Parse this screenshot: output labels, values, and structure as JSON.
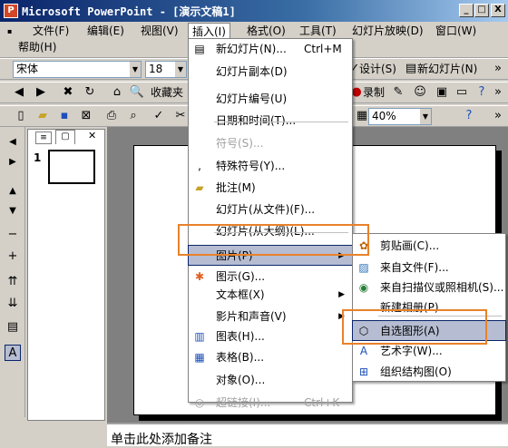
{
  "window": {
    "title": "Microsoft PowerPoint - [演示文稿1]",
    "minimize": "_",
    "restore": "□",
    "close": "X"
  },
  "menubar": {
    "file": "文件(F)",
    "edit": "编辑(E)",
    "view": "视图(V)",
    "insert": "插入(I)",
    "format": "格式(O)",
    "tools": "工具(T)",
    "slideshow": "幻灯片放映(D)",
    "window": "窗口(W)",
    "help": "帮助(H)"
  },
  "toolbar1": {
    "font_name": "宋体",
    "font_size": "18",
    "design": "设计(S)",
    "new_slide": "新幻灯片(N)"
  },
  "toolbar2": {
    "favorites": "收藏夹",
    "record": "录制"
  },
  "toolbar3": {
    "zoom": "40%"
  },
  "outline": {
    "slide_number": "1"
  },
  "notes": {
    "placeholder": "单击此处添加备注"
  },
  "insert_menu": {
    "items": [
      {
        "label": "新幻灯片(N)...",
        "shortcut": "Ctrl+M",
        "icon": "new-slide-icon",
        "disabled": false
      },
      {
        "label": "幻灯片副本(D)",
        "disabled": false
      },
      {
        "label": "幻灯片编号(U)",
        "disabled": false
      },
      {
        "label": "日期和时间(T)...",
        "disabled": false
      },
      {
        "label": "符号(S)...",
        "disabled": true
      },
      {
        "label": "特殊符号(Y)...",
        "icon": "comma-icon",
        "disabled": false
      },
      {
        "label": "批注(M)",
        "icon": "folder-icon",
        "disabled": false
      },
      {
        "label": "幻灯片(从文件)(F)...",
        "disabled": false
      },
      {
        "label": "幻灯片(从大纲)(L)...",
        "disabled": false
      },
      {
        "label": "图片(P)",
        "submenu": true,
        "disabled": false
      },
      {
        "label": "图示(G)...",
        "icon": "diagram-icon",
        "disabled": false
      },
      {
        "label": "文本框(X)",
        "submenu": true,
        "disabled": false
      },
      {
        "label": "影片和声音(V)",
        "submenu": true,
        "disabled": false
      },
      {
        "label": "图表(H)...",
        "icon": "chart-icon",
        "disabled": false
      },
      {
        "label": "表格(B)...",
        "icon": "table-icon",
        "disabled": false
      },
      {
        "label": "对象(O)...",
        "disabled": false
      },
      {
        "label": "超链接(I)...",
        "shortcut": "Ctrl+K",
        "icon": "hyperlink-icon",
        "disabled": true
      }
    ]
  },
  "picture_submenu": {
    "items": [
      {
        "label": "剪贴画(C)...",
        "icon": "clipart-icon"
      },
      {
        "label": "来自文件(F)...",
        "icon": "picture-file-icon"
      },
      {
        "label": "来自扫描仪或照相机(S)...",
        "icon": "scanner-icon"
      },
      {
        "label": "新建相册(P)..."
      },
      {
        "label": "自选图形(A)",
        "icon": "autoshape-icon"
      },
      {
        "label": "艺术字(W)...",
        "icon": "wordart-icon"
      },
      {
        "label": "组织结构图(O)",
        "icon": "org-chart-icon"
      }
    ]
  },
  "colors": {
    "highlight": "#b6bdd2",
    "callout": "#e8822a",
    "titlebar": "#0a246a"
  }
}
